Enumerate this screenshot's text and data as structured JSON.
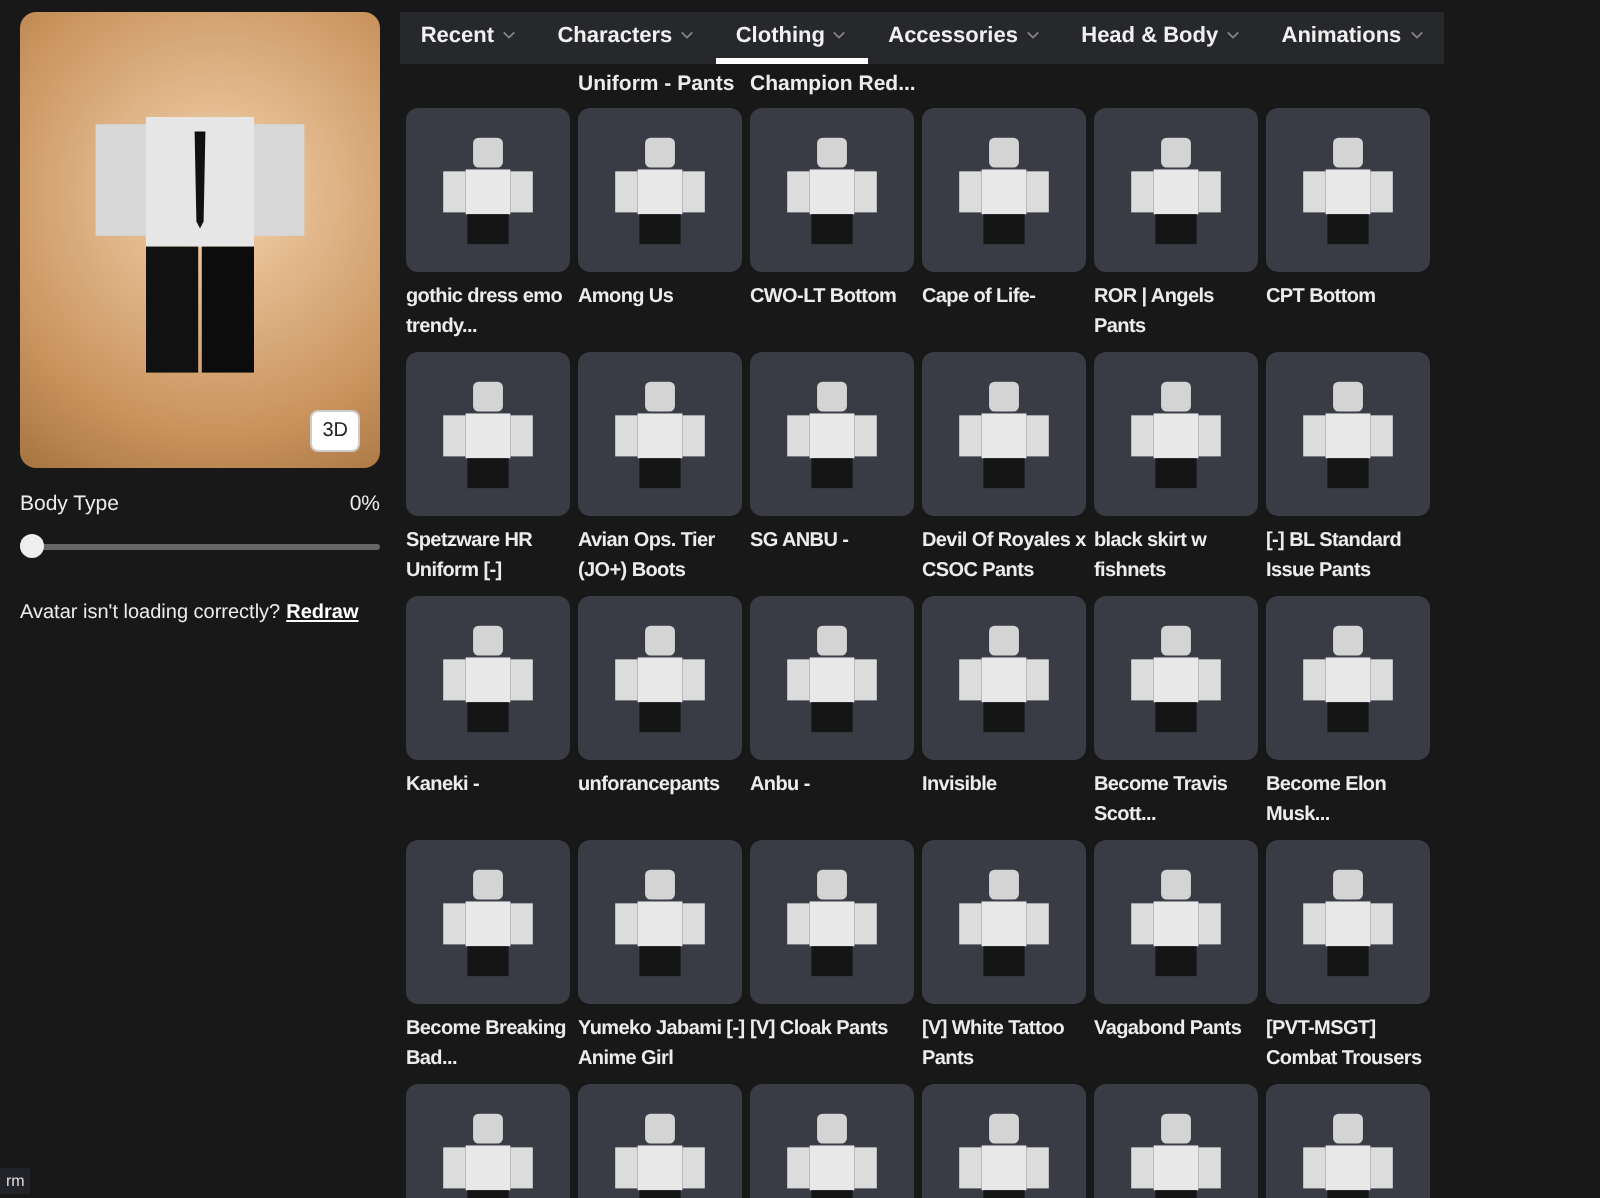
{
  "avatar": {
    "view_button": "3D"
  },
  "body_type": {
    "label": "Body Type",
    "reading": "0%",
    "level": 0
  },
  "help": {
    "text": "Avatar isn't loading correctly?",
    "link": "Redraw"
  },
  "tabs": [
    {
      "label": "Recent",
      "selected": false
    },
    {
      "label": "Characters",
      "selected": false
    },
    {
      "label": "Clothing",
      "selected": true
    },
    {
      "label": "Accessories",
      "selected": false
    },
    {
      "label": "Head & Body",
      "selected": false
    },
    {
      "label": "Animations",
      "selected": false
    }
  ],
  "partial_labels": [
    "Uniform - Pants",
    "Champion Red..."
  ],
  "items": [
    {
      "kind": "item",
      "name": "gothic dress emo trendy..."
    },
    {
      "kind": "item",
      "name": "Among Us"
    },
    {
      "kind": "item",
      "name": "CWO-LT Bottom"
    },
    {
      "kind": "item",
      "name": "Cape of Life-"
    },
    {
      "kind": "item",
      "name": "ROR | Angels Pants"
    },
    {
      "kind": "item",
      "name": "CPT Bottom"
    },
    {
      "kind": "item",
      "name": "Spetzware HR Uniform [-]"
    },
    {
      "kind": "item",
      "name": "Avian Ops. Tier (JO+) Boots"
    },
    {
      "kind": "item",
      "name": "SG ANBU -"
    },
    {
      "kind": "item",
      "name": "Devil Of Royales x CSOC Pants"
    },
    {
      "kind": "item",
      "name": "black skirt w fishnets"
    },
    {
      "kind": "item",
      "name": "[-] BL Standard Issue Pants"
    },
    {
      "kind": "item",
      "name": "Kaneki -"
    },
    {
      "kind": "item",
      "name": "unforancepants"
    },
    {
      "kind": "item",
      "name": "Anbu -"
    },
    {
      "kind": "item",
      "name": "Invisible"
    },
    {
      "kind": "item",
      "name": "Become Travis Scott..."
    },
    {
      "kind": "item",
      "name": "Become Elon Musk..."
    },
    {
      "kind": "item",
      "name": "Become Breaking Bad..."
    },
    {
      "kind": "item",
      "name": "Yumeko Jabami [-] Anime Girl"
    },
    {
      "kind": "item",
      "name": "[V] Cloak Pants"
    },
    {
      "kind": "item",
      "name": "[V] White Tattoo Pants"
    },
    {
      "kind": "item",
      "name": "Vagabond Pants"
    },
    {
      "kind": "item",
      "name": "[PVT-MSGT] Combat Trousers"
    },
    {
      "kind": "cut"
    },
    {
      "kind": "cut"
    },
    {
      "kind": "cut"
    },
    {
      "kind": "cut"
    },
    {
      "kind": "cut"
    },
    {
      "kind": "cut"
    }
  ],
  "corner_text": "rm"
}
